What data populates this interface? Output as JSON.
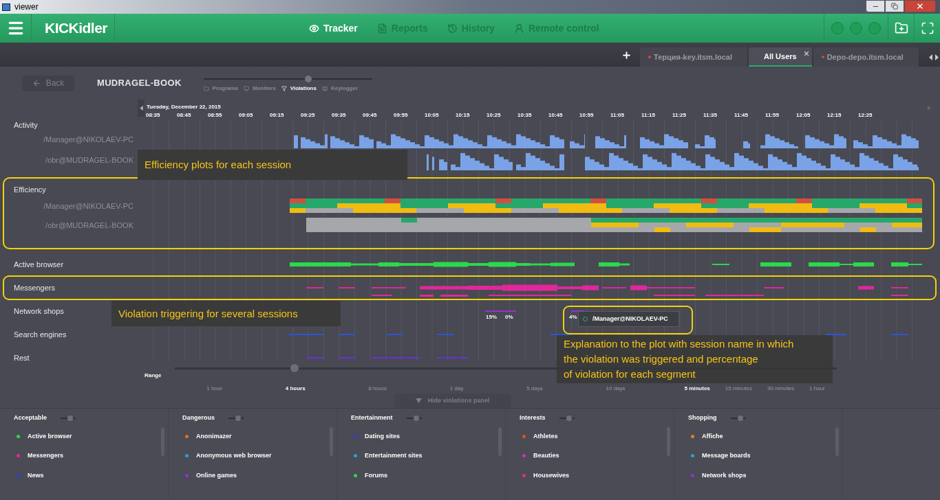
{
  "window": {
    "title": "viewer"
  },
  "header": {
    "logo": "KICKidler",
    "nav": [
      {
        "label": "Tracker",
        "selected": true
      },
      {
        "label": "Reports",
        "selected": false
      },
      {
        "label": "History",
        "selected": false
      },
      {
        "label": "Remote control",
        "selected": false
      }
    ]
  },
  "tabs": [
    {
      "label": "Терция-key.itsm.local",
      "selected": false,
      "color": "#d9483b"
    },
    {
      "label": "All Users",
      "selected": true
    },
    {
      "label": "Depo-depo.itsm.local",
      "selected": false,
      "color": "#d9483b"
    }
  ],
  "device": {
    "back": "Back",
    "name": "MUDRAGEL-BOOK",
    "mode_slider": {
      "level": 0.62
    },
    "modes": [
      {
        "label": "Programs",
        "selected": false
      },
      {
        "label": "Monitors",
        "selected": false
      },
      {
        "label": "Violations",
        "selected": true
      },
      {
        "label": "Keylogger",
        "selected": false
      }
    ]
  },
  "timeline": {
    "date": "Tuesday, December 22, 2015",
    "ticks": [
      "08:35",
      "08:45",
      "08:55",
      "09:05",
      "09:15",
      "09:25",
      "09:35",
      "09:45",
      "09:55",
      "10:05",
      "10:15",
      "10:25",
      "10:35",
      "10:45",
      "10:55",
      "11:05",
      "11:15",
      "11:25",
      "11:35",
      "11:45",
      "11:55",
      "12:05",
      "12:15",
      "12:25"
    ]
  },
  "activity": {
    "label": "Activity",
    "sessions": [
      "/Manager@NIKOLAEV-PC",
      "/obr@MUDRAGEL-BOOK"
    ]
  },
  "efficiency": {
    "label": "Efficiency",
    "sessions": [
      "/Manager@NIKOLAEV-PC",
      "/obr@MUDRAGEL-BOOK"
    ]
  },
  "violations": [
    {
      "label": "Active browser",
      "color": "#2bd94a"
    },
    {
      "label": "Messengers",
      "color": "#e0289a"
    },
    {
      "label": "Network shops",
      "color": "#9b30d0"
    },
    {
      "label": "Search engines",
      "color": "#2f55d4"
    },
    {
      "label": "Rest",
      "color": "#6a2fd8"
    }
  ],
  "segment_percents": [
    "15%",
    "0%",
    "4%"
  ],
  "tooltip": {
    "session": "/Manager@NIKOLAEV-PC"
  },
  "range": {
    "label": "Range",
    "level": 0.18,
    "options": [
      {
        "label": "1 hour",
        "selected": false
      },
      {
        "label": "4 hours",
        "selected": true
      },
      {
        "label": "8 hours",
        "selected": false
      },
      {
        "label": "1 day",
        "selected": false
      },
      {
        "label": "5 days",
        "selected": false
      },
      {
        "label": "10 days",
        "selected": false
      }
    ]
  },
  "step": {
    "options": [
      {
        "label": "5 minutes",
        "selected": true
      },
      {
        "label": "15 minutes",
        "selected": false
      },
      {
        "label": "30 minutes",
        "selected": false
      },
      {
        "label": "1 hour",
        "selected": false
      }
    ]
  },
  "hide_panel": "Hide violations panel",
  "categories": [
    {
      "name": "Acceptable",
      "items": [
        {
          "label": "Active browser",
          "color": "#2bd94a"
        },
        {
          "label": "Messengers",
          "color": "#e0289a"
        },
        {
          "label": "News",
          "color": "#2f3fd0"
        }
      ]
    },
    {
      "name": "Dangerous",
      "items": [
        {
          "label": "Anonimazer",
          "color": "#e07020"
        },
        {
          "label": "Anonymous web browser",
          "color": "#2aa0d8"
        },
        {
          "label": "Online games",
          "color": "#9b30d0"
        }
      ]
    },
    {
      "name": "Entertainment",
      "items": [
        {
          "label": "Dating sites",
          "color": "#2f3fd0"
        },
        {
          "label": "Entertainment sites",
          "color": "#2aa0d8"
        },
        {
          "label": "Forums",
          "color": "#2bd94a"
        }
      ]
    },
    {
      "name": "Interests",
      "items": [
        {
          "label": "Athletes",
          "color": "#e05020"
        },
        {
          "label": "Beauties",
          "color": "#d030c0"
        },
        {
          "label": "Housewives",
          "color": "#e0307a"
        }
      ]
    },
    {
      "name": "Shopping",
      "items": [
        {
          "label": "Affiche",
          "color": "#e08020"
        },
        {
          "label": "Message boards",
          "color": "#2aa0d8"
        },
        {
          "label": "Network shops",
          "color": "#9b30d0"
        }
      ]
    }
  ],
  "annotations": [
    {
      "lines": [
        "Efficiency plots for each session"
      ]
    },
    {
      "lines": [
        "Violation triggering for several sessions"
      ]
    },
    {
      "lines": [
        "Explanation to the plot with session name in which",
        "the violation was triggered and percentage",
        "of violation for each segment"
      ]
    }
  ]
}
